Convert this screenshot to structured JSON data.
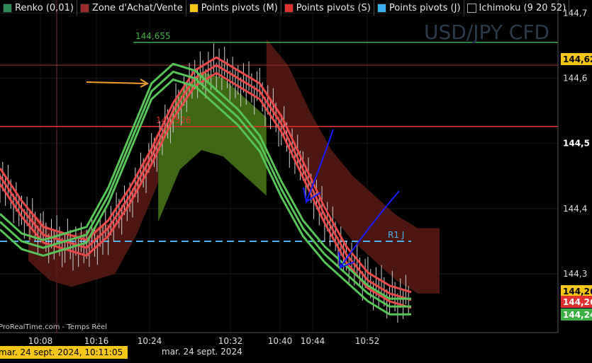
{
  "legend": {
    "items": [
      {
        "label": "Renko (0,01)",
        "icon": "renko-candles-icon",
        "color": "#2e8b57"
      },
      {
        "label": "Zone d'Achat/Vente",
        "icon": "bars-icon",
        "color": "#9b2a2a"
      },
      {
        "label": "Points pivots (M)",
        "icon": "square-icon",
        "color": "#f5c518"
      },
      {
        "label": "Points pivots (S)",
        "icon": "square-icon",
        "color": "#e03030"
      },
      {
        "label": "Points pivots (J)",
        "icon": "square-icon",
        "color": "#3ab0f0"
      },
      {
        "label": "Ichimoku (9 20 52)",
        "icon": "square-icon",
        "color": "#000000"
      }
    ]
  },
  "watermark": "USD/JPY CFD",
  "source_label": "ProRealTime.com - Temps Réel",
  "cursor_time_label": "mar. 24 sept. 2024, 10:11:05",
  "chart_data": {
    "type": "line",
    "title": "USD/JPY CFD",
    "x_date_label": "mar. 24 sept. 2024",
    "x_ticks": [
      "10:08",
      "10:16",
      "10:24",
      "10:32",
      "10:40",
      "10:44",
      "10:52"
    ],
    "y_ticks": [
      "144,7",
      "144,6",
      "144,5",
      "144,4",
      "144,3"
    ],
    "ylim": [
      144.21,
      144.72
    ],
    "levels": [
      {
        "value": 144.655,
        "label": "144,655",
        "color": "#3cb043"
      },
      {
        "value": 144.526,
        "label": "144,526",
        "color": "#e03030"
      },
      {
        "value": 144.35,
        "label": "R1 J",
        "color": "#4fb3ea"
      }
    ],
    "price_tags": [
      {
        "value": 144.62,
        "label": "144,62",
        "bg": "#f5c518",
        "fg": "#000000"
      },
      {
        "value": 144.26,
        "label": "144,26",
        "bg": "#f5c518",
        "fg": "#000000"
      },
      {
        "value": 144.26,
        "label": "144,26",
        "bg": "#e03030",
        "fg": "#ffffff"
      },
      {
        "value": 144.24,
        "label": "144,24",
        "bg": "#3cb043",
        "fg": "#ffffff"
      }
    ],
    "series": [
      {
        "color": "#e84a4a",
        "values": [
          144.45,
          144.4,
          144.36,
          144.35,
          144.34,
          144.37,
          144.42,
          144.48,
          144.55,
          144.6,
          144.62,
          144.6,
          144.58,
          144.53,
          144.46,
          144.39,
          144.33,
          144.29,
          144.27,
          144.26
        ]
      },
      {
        "color": "#56c456",
        "values": [
          144.38,
          144.35,
          144.34,
          144.35,
          144.36,
          144.42,
          144.5,
          144.58,
          144.61,
          144.6,
          144.57,
          144.54,
          144.5,
          144.43,
          144.37,
          144.33,
          144.3,
          144.27,
          144.25,
          144.25
        ]
      }
    ]
  }
}
